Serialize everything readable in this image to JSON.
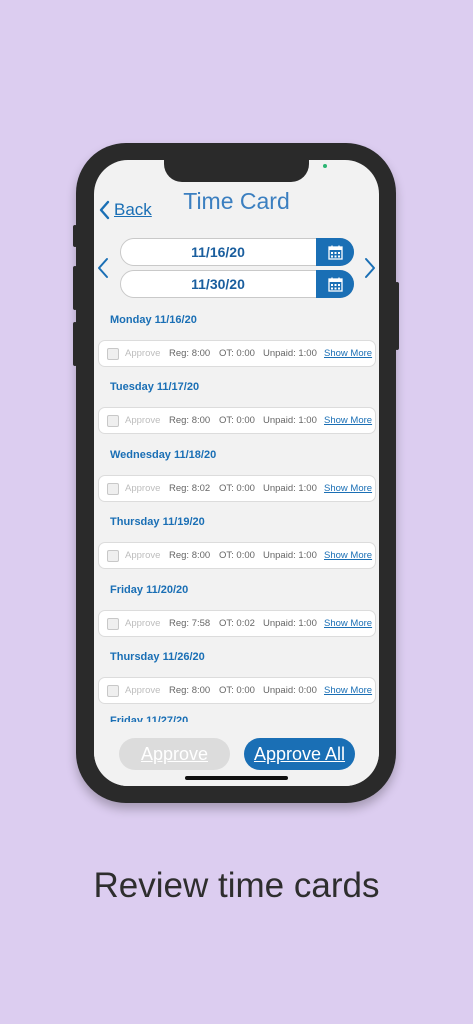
{
  "header": {
    "back_label": "Back",
    "title": "Time Card"
  },
  "date_range": {
    "start": "11/16/20",
    "end": "11/30/20"
  },
  "days": [
    {
      "label": "Monday 11/16/20",
      "approve": "Approve",
      "reg": "Reg: 8:00",
      "ot": "OT: 0:00",
      "unpaid": "Unpaid: 1:00",
      "more": "Show More"
    },
    {
      "label": "Tuesday 11/17/20",
      "approve": "Approve",
      "reg": "Reg: 8:00",
      "ot": "OT: 0:00",
      "unpaid": "Unpaid: 1:00",
      "more": "Show More"
    },
    {
      "label": "Wednesday 11/18/20",
      "approve": "Approve",
      "reg": "Reg: 8:02",
      "ot": "OT: 0:00",
      "unpaid": "Unpaid: 1:00",
      "more": "Show More"
    },
    {
      "label": "Thursday 11/19/20",
      "approve": "Approve",
      "reg": "Reg: 8:00",
      "ot": "OT: 0:00",
      "unpaid": "Unpaid: 1:00",
      "more": "Show More"
    },
    {
      "label": "Friday 11/20/20",
      "approve": "Approve",
      "reg": "Reg: 7:58",
      "ot": "OT: 0:02",
      "unpaid": "Unpaid: 1:00",
      "more": "Show More"
    },
    {
      "label": "Thursday 11/26/20",
      "approve": "Approve",
      "reg": "Reg: 8:00",
      "ot": "OT: 0:00",
      "unpaid": "Unpaid: 0:00",
      "more": "Show More"
    }
  ],
  "partial_day_label": "Friday 11/27/20",
  "actions": {
    "approve": "Approve",
    "approve_all": "Approve All"
  },
  "caption": "Review time cards",
  "colors": {
    "background": "#dccdf0",
    "accent": "#1a6fb5",
    "phone": "#2a2a2a"
  },
  "icons": {
    "back": "chevron-left-icon",
    "calendar": "calendar-icon",
    "prev": "chevron-left-icon",
    "next": "chevron-right-icon"
  }
}
